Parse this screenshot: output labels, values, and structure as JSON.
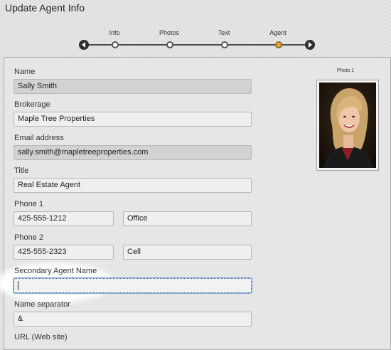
{
  "page": {
    "title": "Update Agent Info"
  },
  "steps": [
    {
      "label": "Info",
      "active": false
    },
    {
      "label": "Photos",
      "active": false
    },
    {
      "label": "Text",
      "active": false
    },
    {
      "label": "Agent",
      "active": true
    }
  ],
  "colors": {
    "active_step": "#f5a623",
    "nav_arrow": "#2f2f2f",
    "focus_border": "#2b62a8"
  },
  "form": {
    "name": {
      "label": "Name",
      "value": "Sally Smith"
    },
    "brokerage": {
      "label": "Brokerage",
      "value": "Maple Tree Properties"
    },
    "email": {
      "label": "Email address",
      "value": "sally.smith@mapletreeproperties.com"
    },
    "title": {
      "label": "Title",
      "value": "Real Estate Agent"
    },
    "phone1": {
      "label": "Phone 1",
      "number": "425-555-1212",
      "type": "Office"
    },
    "phone2": {
      "label": "Phone 2",
      "number": "425-555-2323",
      "type": "Cell"
    },
    "secondary_agent_name": {
      "label": "Secondary Agent Name",
      "value": ""
    },
    "name_separator": {
      "label": "Name separator",
      "value": "&"
    },
    "url": {
      "label": "URL (Web site)"
    }
  },
  "photo": {
    "label": "Photo 1"
  },
  "icons": {
    "prev": "arrow-left-icon",
    "next": "arrow-right-icon"
  }
}
